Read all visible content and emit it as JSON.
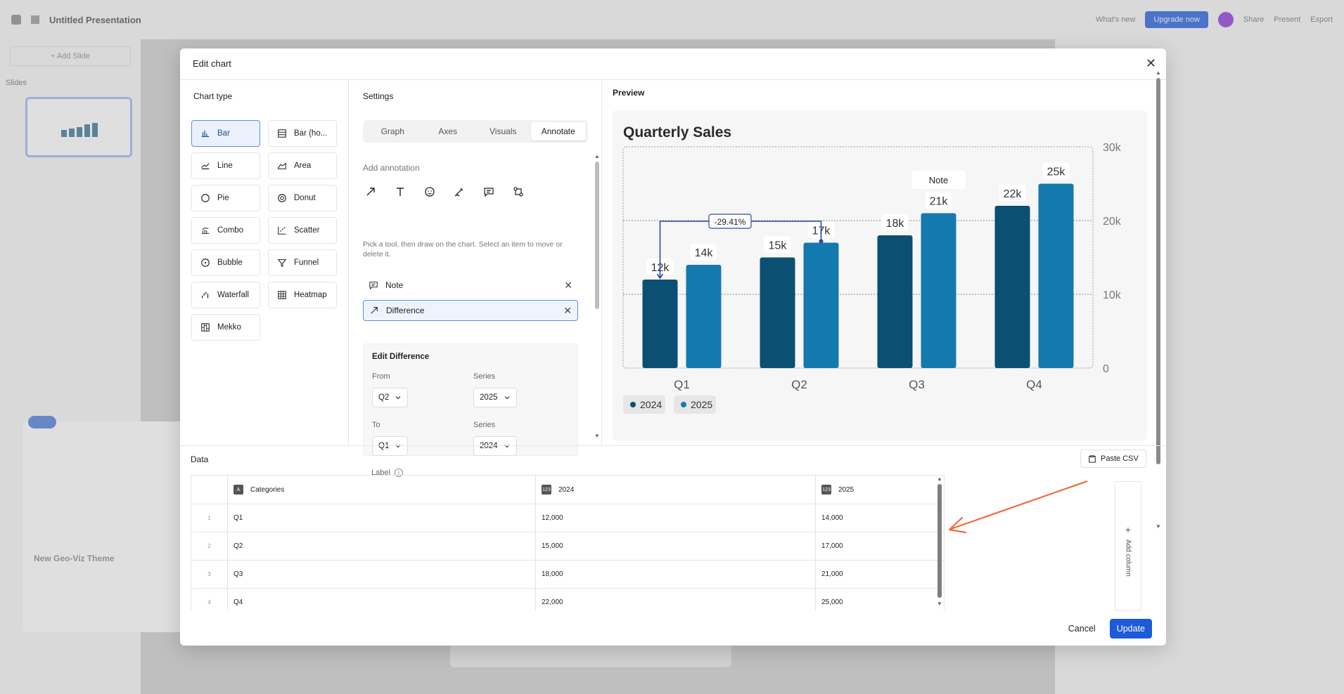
{
  "app": {
    "doc_title": "Untitled Presentation",
    "whats_new": "What's new",
    "upgrade": "Upgrade now",
    "share": "Share",
    "present": "Present",
    "export": "Export",
    "add_slide": "+ Add Slide",
    "slides_label": "Slides",
    "toast_title": "New Geo-Viz Theme"
  },
  "modal": {
    "title": "Edit chart",
    "chart_type_title": "Chart type",
    "chart_types": [
      {
        "label": "Bar",
        "icon": "bar-chart-icon",
        "active": true
      },
      {
        "label": "Bar (ho...",
        "icon": "bar-horizontal-icon",
        "active": false
      },
      {
        "label": "Line",
        "icon": "line-chart-icon",
        "active": false
      },
      {
        "label": "Area",
        "icon": "area-chart-icon",
        "active": false
      },
      {
        "label": "Pie",
        "icon": "pie-chart-icon",
        "active": false
      },
      {
        "label": "Donut",
        "icon": "donut-chart-icon",
        "active": false
      },
      {
        "label": "Combo",
        "icon": "combo-chart-icon",
        "active": false
      },
      {
        "label": "Scatter",
        "icon": "scatter-chart-icon",
        "active": false
      },
      {
        "label": "Bubble",
        "icon": "bubble-chart-icon",
        "active": false
      },
      {
        "label": "Funnel",
        "icon": "funnel-chart-icon",
        "active": false
      },
      {
        "label": "Waterfall",
        "icon": "waterfall-chart-icon",
        "active": false
      },
      {
        "label": "Heatmap",
        "icon": "heatmap-chart-icon",
        "active": false
      },
      {
        "label": "Mekko",
        "icon": "mekko-chart-icon",
        "active": false
      }
    ],
    "settings_title": "Settings",
    "tabs": [
      "Graph",
      "Axes",
      "Visuals",
      "Annotate"
    ],
    "active_tab": "Annotate",
    "add_annotation": "Add annotation",
    "tools": [
      "arrow-tool-icon",
      "text-tool-icon",
      "emoji-tool-icon",
      "draw-tool-icon",
      "note-tool-icon",
      "difference-tool-icon"
    ],
    "hint": "Pick a tool, then draw on the chart. Select an item to move or delete it.",
    "annotations": [
      {
        "label": "Note",
        "icon": "note-icon",
        "selected": false
      },
      {
        "label": "Difference",
        "icon": "arrow-icon",
        "selected": true
      }
    ],
    "edit": {
      "title": "Edit Difference",
      "from_label": "From",
      "from_value": "Q2",
      "from_series_label": "Series",
      "from_series_value": "2025",
      "to_label": "To",
      "to_value": "Q1",
      "to_series_label": "Series",
      "to_series_value": "2024",
      "label_label": "Label"
    },
    "preview_title": "Preview",
    "data_title": "Data",
    "paste_csv": "Paste CSV",
    "add_column": "Add column",
    "table": {
      "headers": [
        "Categories",
        "2024",
        "2025"
      ],
      "header_icons": [
        "A",
        "123",
        "123"
      ],
      "rows": [
        {
          "idx": "1",
          "cat": "Q1",
          "a": "12,000",
          "b": "14,000"
        },
        {
          "idx": "2",
          "cat": "Q2",
          "a": "15,000",
          "b": "17,000"
        },
        {
          "idx": "3",
          "cat": "Q3",
          "a": "18,000",
          "b": "21,000"
        },
        {
          "idx": "4",
          "cat": "Q4",
          "a": "22,000",
          "b": "25,000"
        }
      ]
    },
    "cancel": "Cancel",
    "update": "Update"
  },
  "colors": {
    "series_2024": "#0b4f72",
    "series_2025": "#1479ae",
    "accent": "#1d5ad8",
    "difference_line": "#2a4aa8",
    "annotation_arrow": "#f06a3c"
  },
  "chart_data": {
    "type": "bar",
    "title": "Quarterly Sales",
    "categories": [
      "Q1",
      "Q2",
      "Q3",
      "Q4"
    ],
    "series": [
      {
        "name": "2024",
        "values": [
          12000,
          15000,
          18000,
          22000
        ],
        "labels": [
          "12k",
          "15k",
          "18k",
          "22k"
        ]
      },
      {
        "name": "2025",
        "values": [
          14000,
          17000,
          21000,
          25000
        ],
        "labels": [
          "14k",
          "17k",
          "21k",
          "25k"
        ]
      }
    ],
    "ylim": [
      0,
      30000
    ],
    "y_ticks": [
      {
        "v": 0,
        "label": "0"
      },
      {
        "v": 10000,
        "label": "10k"
      },
      {
        "v": 20000,
        "label": "20k"
      },
      {
        "v": 30000,
        "label": "30k"
      }
    ],
    "y_axis_side": "right",
    "grid": true,
    "legend_position": "bottom-left",
    "annotations": {
      "note": {
        "text": "Note",
        "category": "Q3",
        "series": "2025"
      },
      "difference": {
        "label": "-29.41%",
        "from_category": "Q2",
        "from_series": "2025",
        "to_category": "Q1",
        "to_series": "2024"
      }
    }
  }
}
